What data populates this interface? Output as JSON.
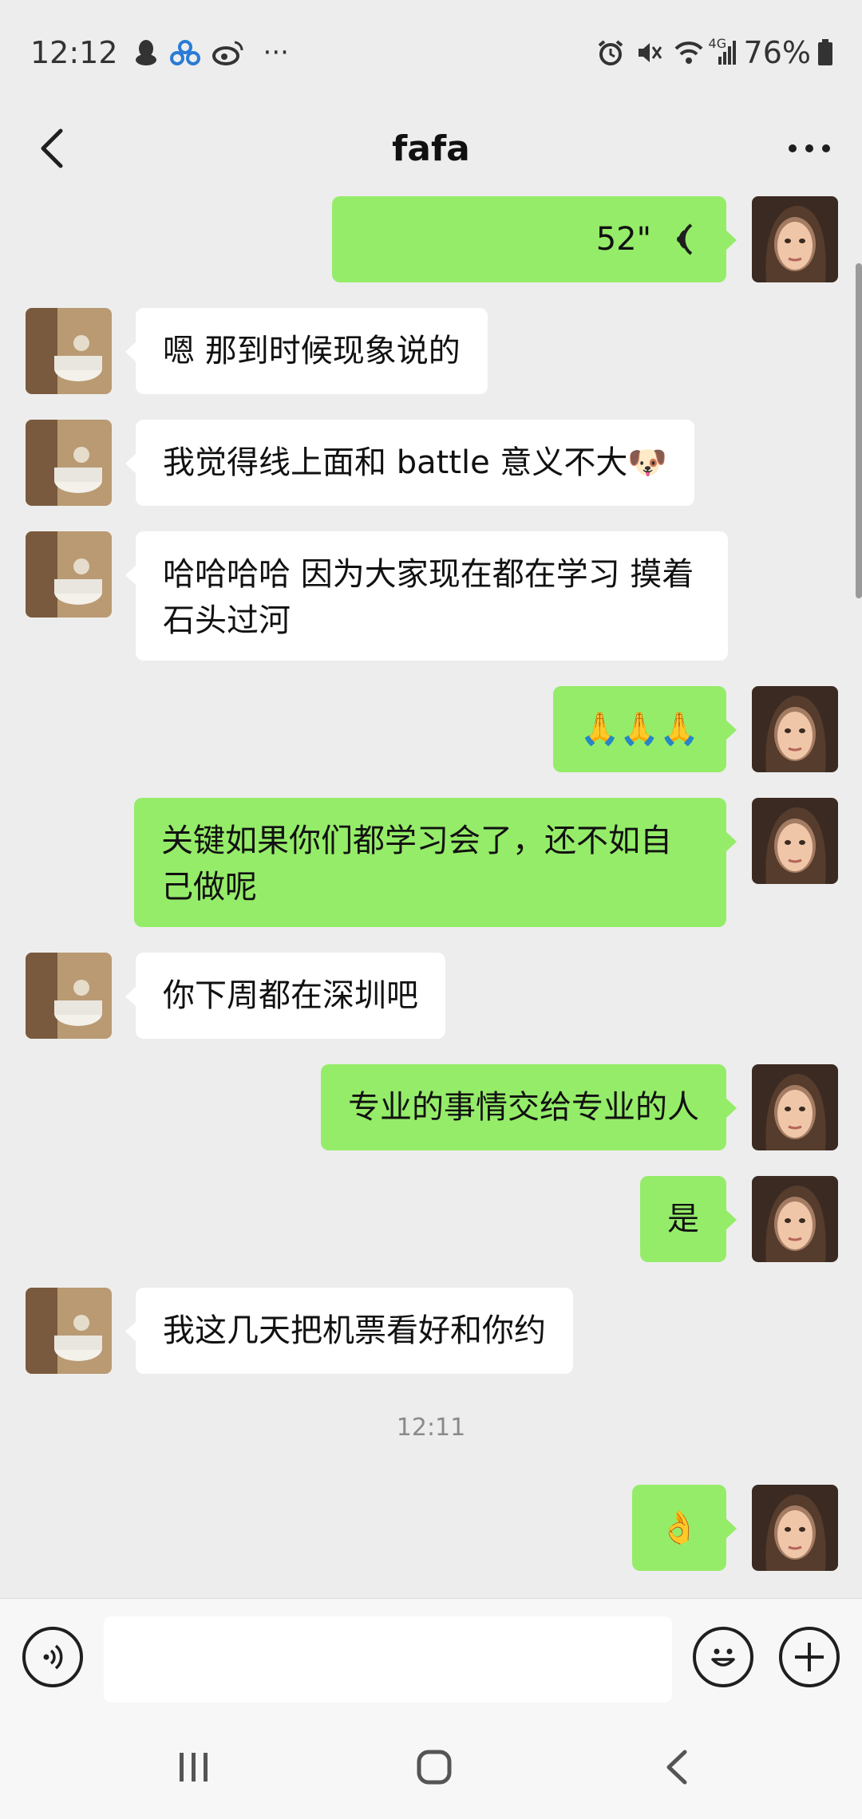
{
  "status_bar": {
    "time": "12:12",
    "more_indicator": "···",
    "network": "4G",
    "battery": "76%"
  },
  "header": {
    "title": "fafa"
  },
  "messages": [
    {
      "sender": "self",
      "type": "voice",
      "duration": "52\""
    },
    {
      "sender": "other",
      "text": "嗯 那到时候现象说的"
    },
    {
      "sender": "other",
      "text": "我觉得线上面和 battle 意义不大",
      "emoji": "🐶"
    },
    {
      "sender": "other",
      "text": "哈哈哈哈 因为大家现在都在学习 摸着石头过河"
    },
    {
      "sender": "self",
      "text": "🙏🙏🙏"
    },
    {
      "sender": "self",
      "text": "关键如果你们都学习会了，还不如自己做呢"
    },
    {
      "sender": "other",
      "text": "你下周都在深圳吧"
    },
    {
      "sender": "self",
      "text": "专业的事情交给专业的人"
    },
    {
      "sender": "self",
      "text": "是"
    },
    {
      "sender": "other",
      "text": "我这几天把机票看好和你约"
    },
    {
      "sender": "self",
      "text": "👌"
    }
  ],
  "timestamp": "12:11",
  "input_bar": {
    "placeholder": ""
  },
  "colors": {
    "self_bubble": "#95ec69",
    "other_bubble": "#ffffff",
    "background": "#ededed"
  }
}
